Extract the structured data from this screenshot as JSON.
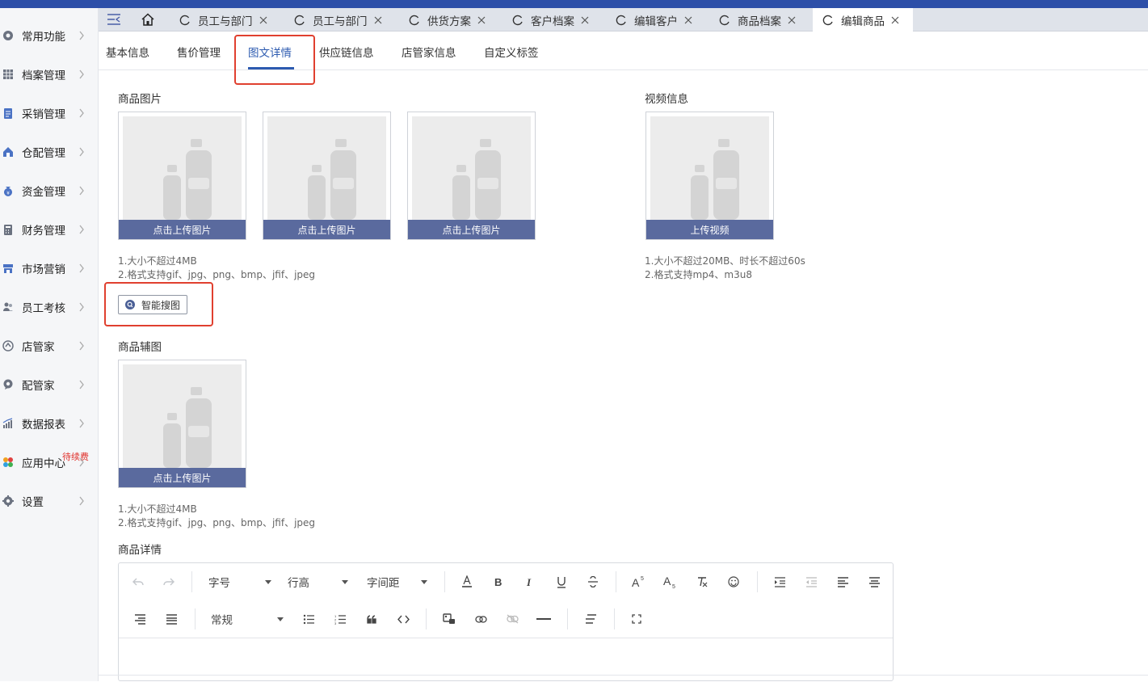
{
  "sidebar": {
    "items": [
      {
        "label": "常用功能",
        "icon": "target-icon"
      },
      {
        "label": "档案管理",
        "icon": "grid-icon"
      },
      {
        "label": "采销管理",
        "icon": "clipboard-icon"
      },
      {
        "label": "仓配管理",
        "icon": "warehouse-icon"
      },
      {
        "label": "资金管理",
        "icon": "money-bag-icon"
      },
      {
        "label": "财务管理",
        "icon": "calculator-icon"
      },
      {
        "label": "市场营销",
        "icon": "store-icon"
      },
      {
        "label": "员工考核",
        "icon": "people-icon"
      },
      {
        "label": "店管家",
        "icon": "shop-icon"
      },
      {
        "label": "配管家",
        "icon": "chat-icon"
      },
      {
        "label": "数据报表",
        "icon": "chart-icon"
      },
      {
        "label": "应用中心",
        "icon": "apps-icon",
        "badge": "待续费"
      },
      {
        "label": "设置",
        "icon": "gear-icon"
      }
    ]
  },
  "tabs": [
    {
      "label": "员工与部门"
    },
    {
      "label": "员工与部门"
    },
    {
      "label": "供货方案"
    },
    {
      "label": "客户档案"
    },
    {
      "label": "编辑客户"
    },
    {
      "label": "商品档案"
    },
    {
      "label": "编辑商品"
    }
  ],
  "subtabs": [
    "基本信息",
    "售价管理",
    "图文详情",
    "供应链信息",
    "店管家信息",
    "自定义标签"
  ],
  "main": {
    "product_images_title": "商品图片",
    "upload_image_label": "点击上传图片",
    "image_hint_1": "1.大小不超过4MB",
    "image_hint_2": "2.格式支持gif、jpg、png、bmp、jfif、jpeg",
    "smart_search_label": "智能搜图",
    "video_title": "视频信息",
    "upload_video_label": "上传视频",
    "video_hint_1": "1.大小不超过20MB、时长不超过60s",
    "video_hint_2": "2.格式支持mp4、m3u8",
    "aux_images_title": "商品辅图",
    "aux_hint_1": "1.大小不超过4MB",
    "aux_hint_2": "2.格式支持gif、jpg、png、bmp、jfif、jpeg",
    "detail_title": "商品详情"
  },
  "editor": {
    "font_size": "字号",
    "line_height": "行高",
    "letter_spacing": "字间距",
    "paragraph_style": "常规"
  },
  "colors": {
    "accent": "#2d5bb0",
    "upload_button": "#5a6a9e",
    "highlight_box": "#e0402f",
    "badge": "#e0312c"
  }
}
